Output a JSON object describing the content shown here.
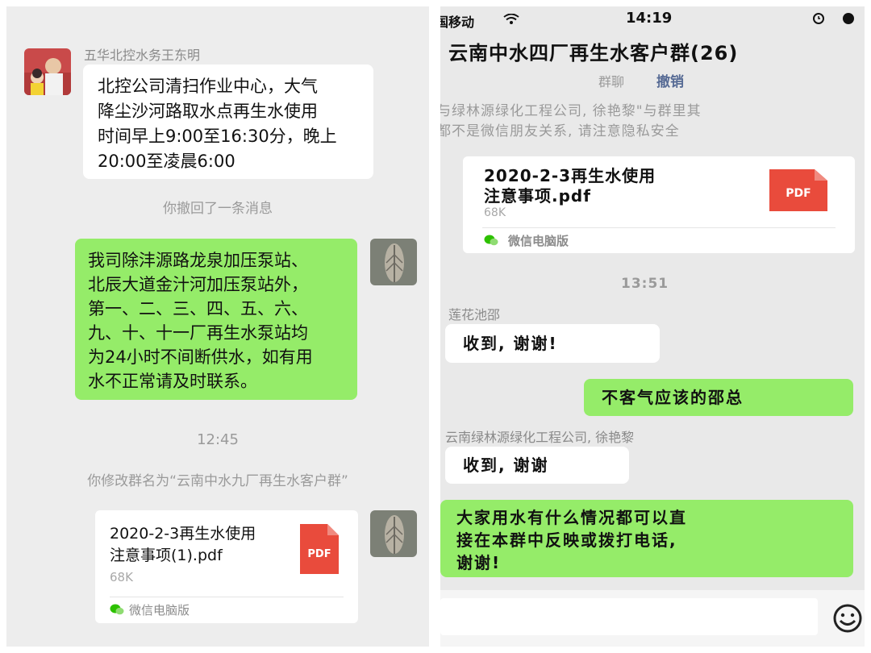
{
  "left": {
    "sender_name": "五华北控水务王东明",
    "msg1": "北控公司清扫作业中心，大气\n降尘沙河路取水点再生水使用\n时间早上9:00至16:30分，晚上\n20:00至凌晨6:00",
    "recalled_notice": "你撤回了一条消息",
    "msg2": "我司除沣源路龙泉加压泵站、\n北辰大道金汁河加压泵站外，\n第一、二、三、四、五、六、\n九、十、十一厂再生水泵站均\n为24小时不间断供水，如有用\n水不正常请及时联系。",
    "time": "12:45",
    "rename_notice": "你修改群名为“云南中水九厂再生水客户群”",
    "file": {
      "name": "2020-2-3再生水使用\n注意事项(1).pdf",
      "size": "68K",
      "icon_label": "PDF",
      "source": "微信电脑版"
    }
  },
  "right": {
    "status_carrier": "国移动",
    "status_time": "14:19",
    "title": "云南中水四厂再生水客户群(26)",
    "subtitle_left": "群聊",
    "subtitle_link": "撤销",
    "notice": "与绿林源绿化工程公司, 徐艳黎\"与群里其\n都不是微信朋友关系, 请注意隐私安全",
    "file": {
      "name": "2020-2-3再生水使用\n注意事项.pdf",
      "size": "68K",
      "icon_label": "PDF",
      "source": "微信电脑版"
    },
    "time": "13:51",
    "sender1": "莲花池邵",
    "msg1": "收到, 谢谢!",
    "msg2": "不客气应该的邵总",
    "sender2": "云南绿林源绿化工程公司, 徐艳黎",
    "msg3": "收到, 谢谢",
    "msg4": "大家用水有什么情况都可以直\n接在本群中反映或拨打电话,\n谢谢!"
  },
  "colors": {
    "green_bubble": "#95ec69",
    "pdf_red": "#e94b3c",
    "link_blue": "#576b95",
    "chat_bg": "#ededed"
  },
  "icons": [
    "wechat-icon",
    "wifi-icon",
    "alarm-icon",
    "emoji-icon",
    "pdf-icon"
  ]
}
